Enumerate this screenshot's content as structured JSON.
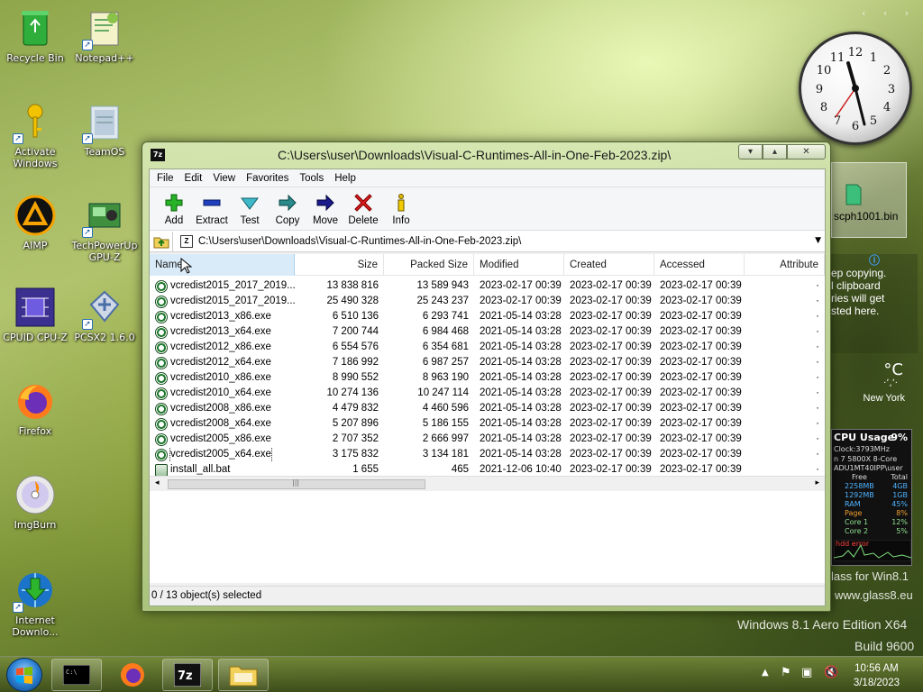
{
  "desktop": {
    "icons": [
      {
        "label": "Recycle Bin"
      },
      {
        "label": "Notepad++"
      },
      {
        "label": "Activate Windows"
      },
      {
        "label": "TeamOS"
      },
      {
        "label": "AIMP"
      },
      {
        "label": "TechPowerUp GPU-Z"
      },
      {
        "label": "CPUID CPU-Z"
      },
      {
        "label": "PCSX2 1.6.0"
      },
      {
        "label": "Firefox"
      },
      {
        "label": "ImgBurn"
      },
      {
        "label": "Internet Downlo..."
      }
    ],
    "file_icon_label": "scph1001.bin",
    "clipboard_text": [
      "ep copying.",
      "l clipboard",
      "ries will get",
      "sted here."
    ],
    "weather": {
      "unit": "°C",
      "location": "New York"
    },
    "cpu_meter": {
      "title": "CPU Usage",
      "percent": "9%",
      "clock": "Clock:3793MHz",
      "cpu": "n 7 5800X 8-Core",
      "user": "ADU1MT40IPP\\user",
      "free_label": "Free",
      "total_label": "Total",
      "rows": [
        {
          "label": "",
          "free": "2258MB",
          "total": "4GB"
        },
        {
          "label": "",
          "free": "1292MB",
          "total": "1GB"
        },
        {
          "label": "RAM",
          "free": "",
          "total": "45%"
        },
        {
          "label": "Page",
          "free": "",
          "total": "8%"
        },
        {
          "label": "Core 1",
          "free": "",
          "total": "12%"
        },
        {
          "label": "Core 2",
          "free": "",
          "total": "5%"
        }
      ],
      "error": "hdd error"
    },
    "watermark": {
      "glass": "lass for Win8.1",
      "site": "www.glass8.eu",
      "edition": "Windows 8.1 Aero Edition X64",
      "build": "Build 9600"
    }
  },
  "window": {
    "title": "C:\\Users\\user\\Downloads\\Visual-C-Runtimes-All-in-One-Feb-2023.zip\\",
    "app_icon_text": "7z",
    "menu": [
      "File",
      "Edit",
      "View",
      "Favorites",
      "Tools",
      "Help"
    ],
    "toolbar": [
      {
        "label": "Add",
        "icon": "add-icon"
      },
      {
        "label": "Extract",
        "icon": "extract-icon"
      },
      {
        "label": "Test",
        "icon": "test-icon"
      },
      {
        "label": "Copy",
        "icon": "copy-icon"
      },
      {
        "label": "Move",
        "icon": "move-icon"
      },
      {
        "label": "Delete",
        "icon": "delete-icon"
      },
      {
        "label": "Info",
        "icon": "info-icon"
      }
    ],
    "address": "C:\\Users\\user\\Downloads\\Visual-C-Runtimes-All-in-One-Feb-2023.zip\\",
    "columns": [
      "Name",
      "Size",
      "Packed Size",
      "Modified",
      "Created",
      "Accessed",
      "Attribute"
    ],
    "files": [
      {
        "name": "vcredist2015_2017_2019...",
        "size": "13 838 816",
        "packed": "13 589 943",
        "modified": "2023-02-17 00:39",
        "created": "2023-02-17 00:39",
        "accessed": "2023-02-17 00:39"
      },
      {
        "name": "vcredist2015_2017_2019...",
        "size": "25 490 328",
        "packed": "25 243 237",
        "modified": "2023-02-17 00:39",
        "created": "2023-02-17 00:39",
        "accessed": "2023-02-17 00:39"
      },
      {
        "name": "vcredist2013_x86.exe",
        "size": "6 510 136",
        "packed": "6 293 741",
        "modified": "2021-05-14 03:28",
        "created": "2023-02-17 00:39",
        "accessed": "2023-02-17 00:39"
      },
      {
        "name": "vcredist2013_x64.exe",
        "size": "7 200 744",
        "packed": "6 984 468",
        "modified": "2021-05-14 03:28",
        "created": "2023-02-17 00:39",
        "accessed": "2023-02-17 00:39"
      },
      {
        "name": "vcredist2012_x86.exe",
        "size": "6 554 576",
        "packed": "6 354 681",
        "modified": "2021-05-14 03:28",
        "created": "2023-02-17 00:39",
        "accessed": "2023-02-17 00:39"
      },
      {
        "name": "vcredist2012_x64.exe",
        "size": "7 186 992",
        "packed": "6 987 257",
        "modified": "2021-05-14 03:28",
        "created": "2023-02-17 00:39",
        "accessed": "2023-02-17 00:39"
      },
      {
        "name": "vcredist2010_x86.exe",
        "size": "8 990 552",
        "packed": "8 963 190",
        "modified": "2021-05-14 03:28",
        "created": "2023-02-17 00:39",
        "accessed": "2023-02-17 00:39"
      },
      {
        "name": "vcredist2010_x64.exe",
        "size": "10 274 136",
        "packed": "10 247 114",
        "modified": "2021-05-14 03:28",
        "created": "2023-02-17 00:39",
        "accessed": "2023-02-17 00:39"
      },
      {
        "name": "vcredist2008_x86.exe",
        "size": "4 479 832",
        "packed": "4 460 596",
        "modified": "2021-05-14 03:28",
        "created": "2023-02-17 00:39",
        "accessed": "2023-02-17 00:39"
      },
      {
        "name": "vcredist2008_x64.exe",
        "size": "5 207 896",
        "packed": "5 186 155",
        "modified": "2021-05-14 03:28",
        "created": "2023-02-17 00:39",
        "accessed": "2023-02-17 00:39"
      },
      {
        "name": "vcredist2005_x86.exe",
        "size": "2 707 352",
        "packed": "2 666 997",
        "modified": "2021-05-14 03:28",
        "created": "2023-02-17 00:39",
        "accessed": "2023-02-17 00:39"
      },
      {
        "name": "vcredist2005_x64.exe",
        "size": "3 175 832",
        "packed": "3 134 181",
        "modified": "2021-05-14 03:28",
        "created": "2023-02-17 00:39",
        "accessed": "2023-02-17 00:39"
      },
      {
        "name": "install_all.bat",
        "size": "1 655",
        "packed": "465",
        "modified": "2021-12-06 10:40",
        "created": "2023-02-17 00:39",
        "accessed": "2023-02-17 00:39"
      }
    ],
    "status": "0 / 13 object(s) selected"
  },
  "taskbar": {
    "items": [
      "cmd",
      "firefox",
      "7z",
      "explorer"
    ],
    "time": "10:56 AM",
    "date": "3/18/2023"
  }
}
